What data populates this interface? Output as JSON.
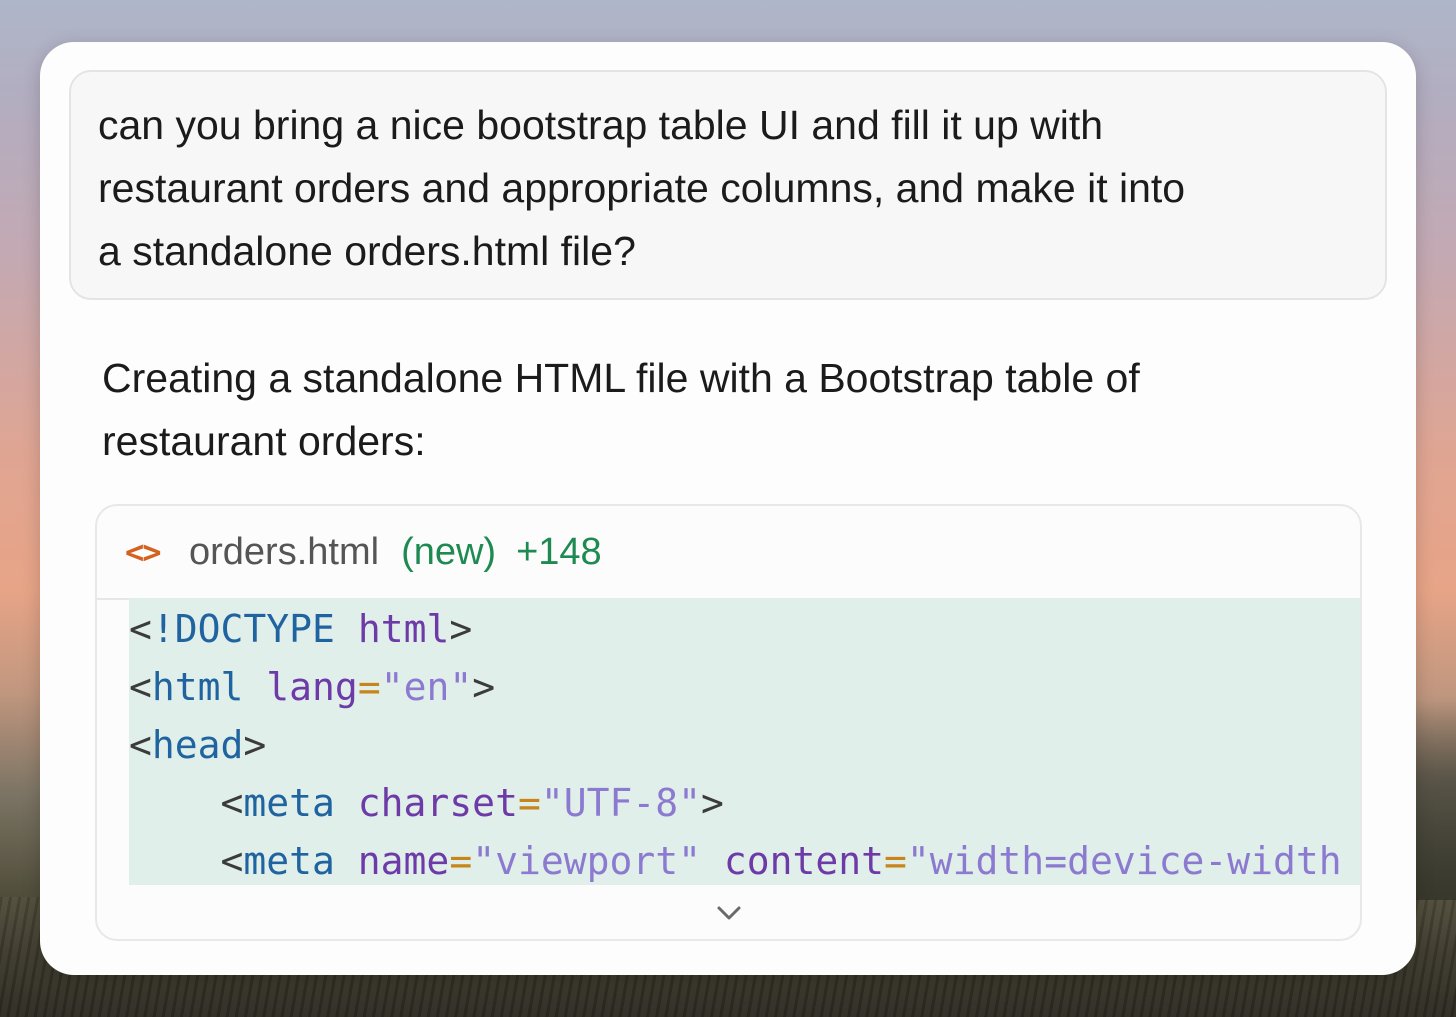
{
  "conversation": {
    "user_message": {
      "lines": [
        "can you bring a nice bootstrap table UI and fill it up with",
        "restaurant orders and appropriate columns, and make it into",
        "a standalone orders.html file?"
      ]
    },
    "assistant_message": {
      "lines": [
        "Creating a standalone HTML file with a Bootstrap table of",
        "restaurant orders:"
      ]
    }
  },
  "code_block": {
    "icon": "code-icon",
    "filename": "orders.html",
    "status": "(new)",
    "added_lines": "+148",
    "lines": [
      [
        {
          "cls": "t-punc",
          "text": "<"
        },
        {
          "cls": "t-kw",
          "text": "!DOCTYPE"
        },
        {
          "cls": "t-punc",
          "text": " "
        },
        {
          "cls": "t-attr",
          "text": "html"
        },
        {
          "cls": "t-punc",
          "text": ">"
        }
      ],
      [
        {
          "cls": "t-punc",
          "text": "<"
        },
        {
          "cls": "t-tag",
          "text": "html"
        },
        {
          "cls": "t-punc",
          "text": " "
        },
        {
          "cls": "t-attr",
          "text": "lang"
        },
        {
          "cls": "t-eq",
          "text": "="
        },
        {
          "cls": "t-str",
          "text": "\"en\""
        },
        {
          "cls": "t-punc",
          "text": ">"
        }
      ],
      [
        {
          "cls": "t-punc",
          "text": "<"
        },
        {
          "cls": "t-tag",
          "text": "head"
        },
        {
          "cls": "t-punc",
          "text": ">"
        }
      ],
      [
        {
          "cls": "t-punc",
          "text": "    <"
        },
        {
          "cls": "t-tag",
          "text": "meta"
        },
        {
          "cls": "t-punc",
          "text": " "
        },
        {
          "cls": "t-attr",
          "text": "charset"
        },
        {
          "cls": "t-eq",
          "text": "="
        },
        {
          "cls": "t-str",
          "text": "\"UTF-8\""
        },
        {
          "cls": "t-punc",
          "text": ">"
        }
      ],
      [
        {
          "cls": "t-punc",
          "text": "    <"
        },
        {
          "cls": "t-tag",
          "text": "meta"
        },
        {
          "cls": "t-punc",
          "text": " "
        },
        {
          "cls": "t-attr",
          "text": "name"
        },
        {
          "cls": "t-eq",
          "text": "="
        },
        {
          "cls": "t-str",
          "text": "\"viewport\""
        },
        {
          "cls": "t-punc",
          "text": " "
        },
        {
          "cls": "t-attr",
          "text": "content"
        },
        {
          "cls": "t-eq",
          "text": "="
        },
        {
          "cls": "t-str",
          "text": "\"width=device-width"
        }
      ]
    ],
    "expand_icon": "chevron-down-icon"
  },
  "colors": {
    "accent_green": "#1e8a52",
    "code_icon_orange": "#d4621f",
    "added_background": "#e0efe9"
  }
}
